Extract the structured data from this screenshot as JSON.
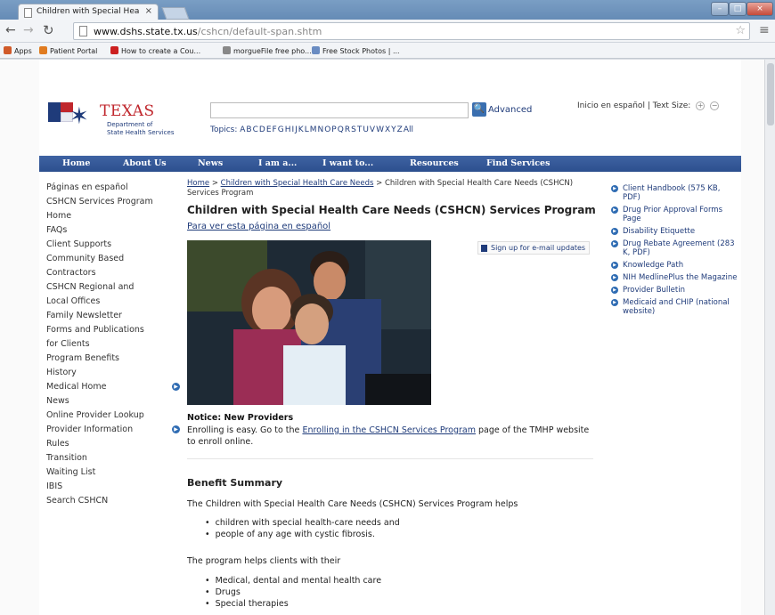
{
  "browser": {
    "tab_title": "Children with Special Hea",
    "tab_close": "×",
    "url_host": "www.dshs.state.tx.us",
    "url_path": "/cshcn/default-span.shtm",
    "bookmarks": [
      {
        "label": "Apps",
        "icon": "apps-icon",
        "color": "#d05a2a"
      },
      {
        "label": "Patient Portal",
        "icon": "globe-icon",
        "color": "#e07b20"
      },
      {
        "label": "How to create a Cou...",
        "icon": "youtube-icon",
        "color": "#cc1f1f"
      },
      {
        "label": "morgueFile free pho...",
        "icon": "page-icon",
        "color": "#888888"
      },
      {
        "label": "Free Stock Photos | ...",
        "icon": "image-icon",
        "color": "#6a8cc2"
      }
    ]
  },
  "header": {
    "logo_title": "TEXAS",
    "logo_sub1": "Department of",
    "logo_sub2": "State Health Services",
    "search_placeholder": "",
    "advanced_label": "Advanced",
    "topics_label": "Topics:",
    "topics_letters": [
      "A",
      "B",
      "C",
      "D",
      "E",
      "F",
      "G",
      "H",
      "I",
      "J",
      "K",
      "L",
      "M",
      "N",
      "O",
      "P",
      "Q",
      "R",
      "S",
      "T",
      "U",
      "V",
      "W",
      "X",
      "Y",
      "Z",
      "All"
    ],
    "util_spanish": "Inicio en español",
    "util_sep": "|",
    "util_textsize": "Text Size:",
    "util_plus": "+",
    "util_minus": "−"
  },
  "mainnav": [
    "Home",
    "About Us",
    "News",
    "I am a...",
    "I want to...",
    "Resources",
    "Find Services"
  ],
  "leftnav": [
    {
      "label": "Páginas en español",
      "arrow": false
    },
    {
      "label": "CSHCN Services Program Home",
      "arrow": false
    },
    {
      "label": "FAQs",
      "arrow": false
    },
    {
      "label": "Client Supports",
      "arrow": false
    },
    {
      "label": "Community Based Contractors",
      "arrow": false
    },
    {
      "label": "CSHCN Regional and Local Offices",
      "arrow": false
    },
    {
      "label": "Family Newsletter",
      "arrow": false
    },
    {
      "label": "Forms and Publications for Clients",
      "arrow": false
    },
    {
      "label": "Program Benefits",
      "arrow": false
    },
    {
      "label": "History",
      "arrow": false
    },
    {
      "label": "Medical Home",
      "arrow": true
    },
    {
      "label": "News",
      "arrow": false
    },
    {
      "label": "Online Provider Lookup",
      "arrow": false
    },
    {
      "label": "Provider Information",
      "arrow": true
    },
    {
      "label": "Rules",
      "arrow": false
    },
    {
      "label": "Transition",
      "arrow": false
    },
    {
      "label": "Waiting List",
      "arrow": false
    },
    {
      "label": "IBIS",
      "arrow": false
    },
    {
      "label": "Search CSHCN",
      "arrow": false
    }
  ],
  "main": {
    "crumb_home": "Home",
    "crumb_sep": ">",
    "crumb_cshcn": "Children with Special Health Care Needs",
    "crumb_current": "Children with Special Health Care Needs (CSHCN) Services Program",
    "title": "Children with Special Health Care Needs (CSHCN) Services Program",
    "spanish_link": "Para ver esta página en español",
    "signup_label": "Sign up for e-mail updates",
    "notice_title": "Notice: New Providers",
    "notice_pre": "Enrolling is easy. Go to the",
    "notice_link": "Enrolling in the CSHCN Services Program",
    "notice_post": "page of the TMHP website to enroll online.",
    "benefit_title": "Benefit Summary",
    "benefit_intro": "The Children with Special Health Care Needs (CSHCN) Services Program helps",
    "benefit_list": [
      "children with special health-care needs and",
      "people of any age with cystic fibrosis."
    ],
    "helps_intro": "The program helps clients with their",
    "helps_list": [
      "Medical, dental and mental health care",
      "Drugs",
      "Special therapies"
    ]
  },
  "rightcol": [
    "Client Handbook (575 KB, PDF)",
    "Drug Prior Approval Forms Page",
    "Disability Etiquette",
    "Drug Rebate Agreement (283 K, PDF)",
    "Knowledge Path",
    "NIH MedlinePlus the Magazine",
    "Provider Bulletin",
    "Medicaid and CHIP (national website)"
  ]
}
